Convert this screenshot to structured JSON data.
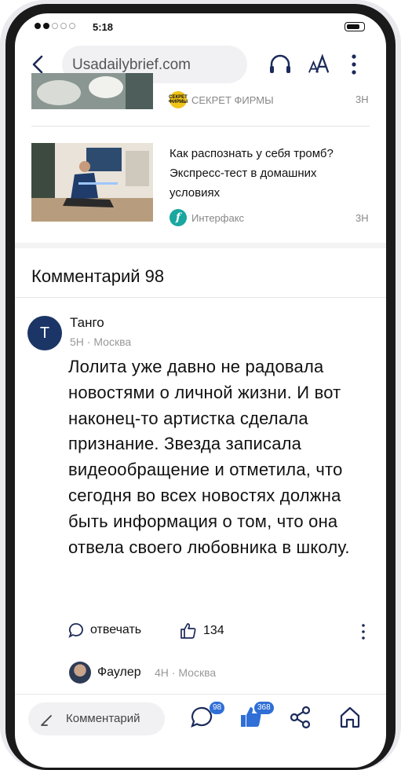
{
  "status_bar": {
    "time": "5:18"
  },
  "browser": {
    "url": "Usadailybrief.com",
    "icons": [
      "back-arrow-icon",
      "headphones-icon",
      "font-size-icon",
      "more-vertical-icon"
    ]
  },
  "articles": [
    {
      "source": "СЕКРЕТ ФИРМЫ",
      "source_logo_text": "СЕКРЕТ ФИРМЫ",
      "age": "3Н"
    },
    {
      "headline": "Как распознать у себя тромб? Экспресс-тест в домашних условиях",
      "source": "Интерфакс",
      "source_logo_text": "f",
      "age": "3Н"
    }
  ],
  "comments_header": "Комментарий 98",
  "comment": {
    "avatar_letter": "T",
    "author": "Танго",
    "meta": "5Н · Москва",
    "text": "Лолита уже давно не радовала новостями о личной жизни. И вот наконец-то артистка сделала признание. Звезда записала видеообращение и отметила, что сегодня во всех новостях должна быть информация о том, что она отвела своего любовника в школу.",
    "reply_label": "отвечать",
    "likes": "134"
  },
  "reply_preview": {
    "author": "Фаулер",
    "meta": "4Н · Москва"
  },
  "bottom_bar": {
    "comment_placeholder": "Комментарий",
    "comments_badge": "98",
    "likes_badge": "368"
  },
  "colors": {
    "accent": "#2f6fd6",
    "avatar_bg": "#1b3566",
    "logo_green": "#19a7a0",
    "logo_yellow": "#f0c419"
  }
}
